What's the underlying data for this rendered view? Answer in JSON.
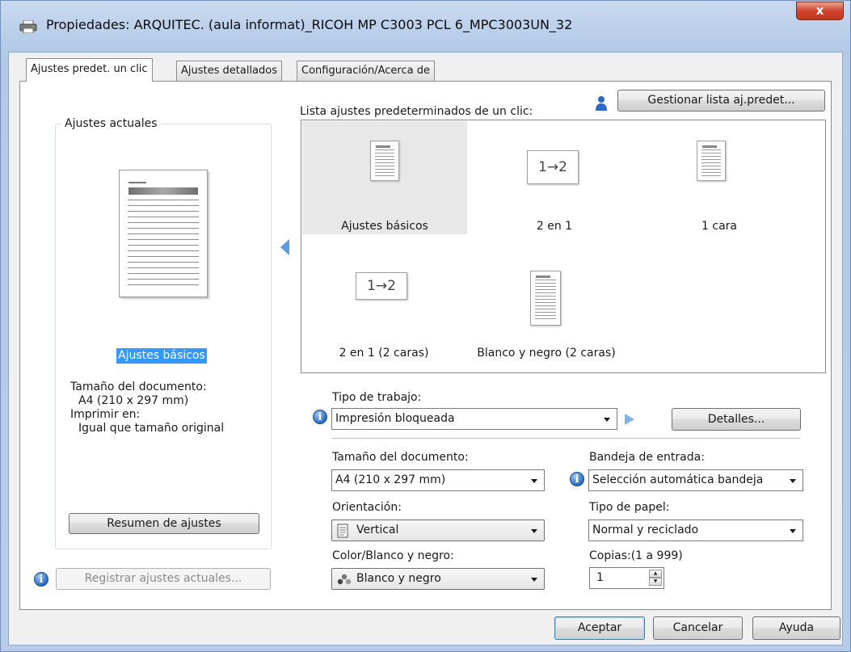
{
  "window": {
    "title": "Propiedades: ARQUITEC. (aula informat)_RICOH MP C3003 PCL 6_MPC3003UN_32",
    "close_glyph": "x"
  },
  "tabs": [
    {
      "label": "Ajustes predet. un clic",
      "active": true
    },
    {
      "label": "Ajustes detallados",
      "active": false
    },
    {
      "label": "Configuración/Acerca de",
      "active": false
    }
  ],
  "current_settings": {
    "group_title": "Ajustes actuales",
    "selected_preset": "Ajustes básicos",
    "doc_size_label": "Tamaño del documento:",
    "doc_size_value": "A4 (210 x 297 mm)",
    "print_on_label": "Imprimir en:",
    "print_on_value": "Igual que tamaño original",
    "summary_button": "Resumen de ajustes",
    "register_button": "Registrar ajustes actuales..."
  },
  "preset_list": {
    "label": "Lista ajustes predeterminados de un clic:",
    "manage_button": "Gestionar lista aj.predet...",
    "items": [
      {
        "label": "Ajustes básicos",
        "icon": "document-icon",
        "selected": true
      },
      {
        "label": "2 en 1",
        "icon": "two-in-one-icon",
        "glyph": "1→2",
        "selected": false
      },
      {
        "label": "1 cara",
        "icon": "document-icon",
        "selected": false
      },
      {
        "label": "2 en 1 (2 caras)",
        "icon": "two-in-one-duplex-icon",
        "glyph": "1→2",
        "selected": false
      },
      {
        "label": "Blanco y negro (2 caras)",
        "icon": "duplex-document-icon",
        "selected": false
      }
    ]
  },
  "job": {
    "type_label": "Tipo de trabajo:",
    "type_value": "Impresión bloqueada",
    "details_button": "Detalles..."
  },
  "fields": {
    "doc_size_label": "Tamaño del documento:",
    "doc_size_value": "A4 (210 x 297 mm)",
    "tray_label": "Bandeja de entrada:",
    "tray_value": "Selección automática bandeja",
    "orientation_label": "Orientación:",
    "orientation_value": "Vertical",
    "paper_type_label": "Tipo de papel:",
    "paper_type_value": "Normal y reciclado",
    "color_label": "Color/Blanco y negro:",
    "color_value": "Blanco y negro",
    "copies_label": "Copias:(1 a 999)",
    "copies_value": "1"
  },
  "footer": {
    "ok": "Aceptar",
    "cancel": "Cancelar",
    "help": "Ayuda"
  },
  "colors": {
    "selection": "#3399ff",
    "arrow": "#5b9be0",
    "close": "#c23a22"
  }
}
